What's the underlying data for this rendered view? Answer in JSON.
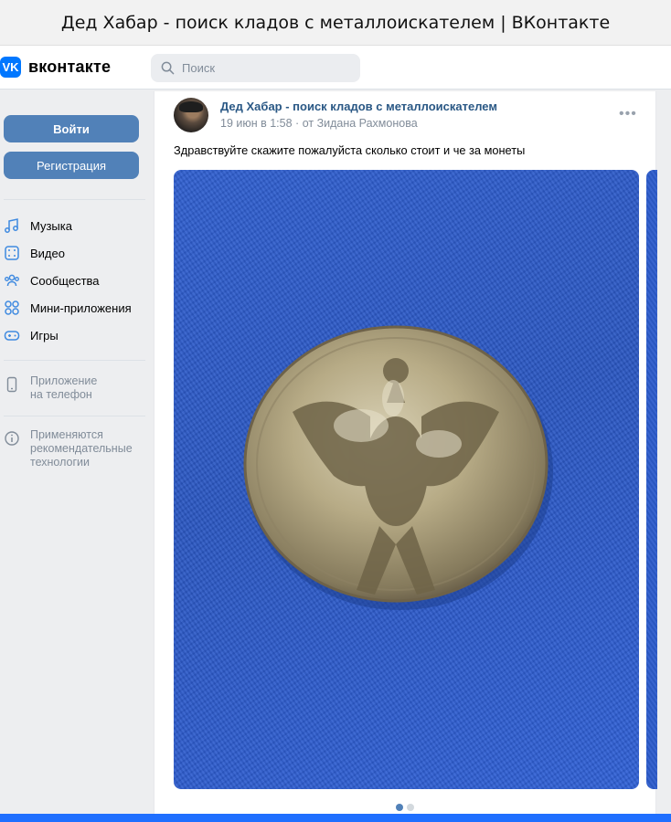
{
  "window": {
    "title": "Дед Хабар - поиск кладов с металлоискателем | ВКонтакте"
  },
  "header": {
    "logo_text": "вконтакте",
    "logo_mark": "VK",
    "search_placeholder": "Поиск",
    "icons": [
      "search-icon"
    ]
  },
  "sidebar": {
    "login_label": "Войти",
    "register_label": "Регистрация",
    "items": [
      {
        "label": "Музыка",
        "icon": "music-icon"
      },
      {
        "label": "Видео",
        "icon": "video-icon"
      },
      {
        "label": "Сообщества",
        "icon": "communities-icon"
      },
      {
        "label": "Мини-приложения",
        "icon": "apps-icon"
      },
      {
        "label": "Игры",
        "icon": "games-icon"
      }
    ],
    "app_note": "Приложение\nна телефон",
    "rec_note": "Применяются\nрекомендательные\nтехнологии"
  },
  "post": {
    "author": "Дед Хабар - поиск кладов с металлоискателем",
    "date": "19 июн в 1:58",
    "separator": "·",
    "from": "от Зидана Рахмонова",
    "more": "•••",
    "text": "Здравствуйте скажите пожалуйста сколько стоит и че за монеты",
    "photo_subject": "silver coin with double-headed eagle on blue fabric",
    "carousel": {
      "current": 1,
      "total": 2
    }
  },
  "colors": {
    "accent": "#5181b8",
    "brand": "#0077ff",
    "link": "#2a5885",
    "muted": "#818c99",
    "background": "#edeef0"
  }
}
